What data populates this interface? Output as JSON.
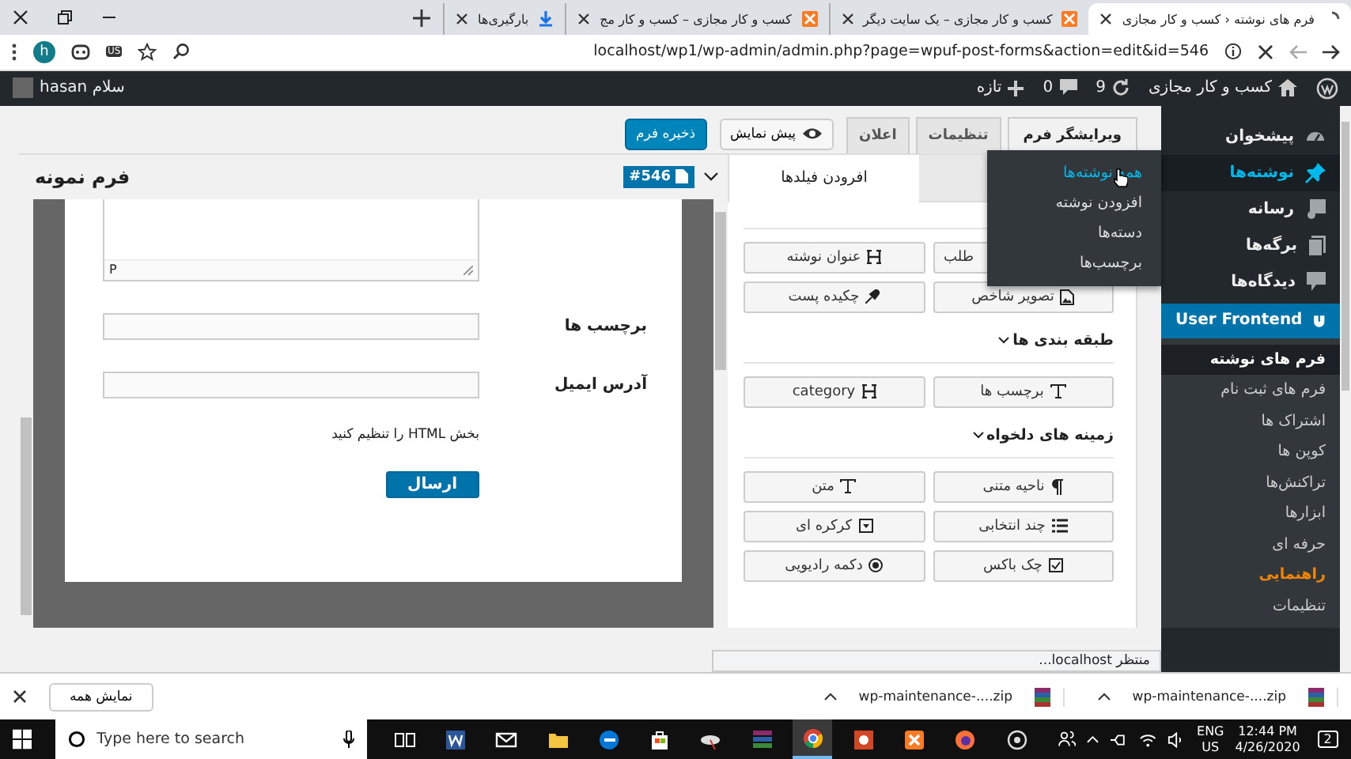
{
  "browser": {
    "tabs": [
      {
        "title": "فرم های نوشته ‹ کسب و کار مجازی",
        "kind": "loading",
        "selected": true
      },
      {
        "title": "کسب و کار مجازی – یک سایت دیگر",
        "kind": "site",
        "selected": false
      },
      {
        "title": "کسب و کار مجازی – کسب و کار مج",
        "kind": "site",
        "selected": false
      },
      {
        "title": "بارگیری‌ها",
        "kind": "download",
        "selected": false
      }
    ],
    "url": "localhost/wp1/wp-admin/admin.php?page=wpuf-post-forms&action=edit&id=546",
    "profile": "h",
    "extension_badge": "US"
  },
  "admin_bar": {
    "site": "کسب و کار مجازی",
    "updates": "9",
    "comments": "0",
    "new": "تازه",
    "greeting": "سلام hasan"
  },
  "toolbar": {
    "tabs": [
      {
        "label": "ویرایشگر فرم",
        "selected": true
      },
      {
        "label": "تنظیمات",
        "selected": false
      },
      {
        "label": "اعلان",
        "selected": false
      }
    ],
    "preview": "پیش نمایش",
    "save": "ذخیره فرم"
  },
  "form_preview": {
    "title": "فرم نمونه",
    "id_badge": "#546",
    "editor_path": "P",
    "fields": [
      {
        "label": "برچسب ها"
      },
      {
        "label": "آدرس ایمیل"
      }
    ],
    "html_note": "بخش HTML را تنظیم کنید",
    "submit": "ارسال"
  },
  "fields_panel": {
    "tab": "افرودن فیلدها",
    "post_fields": [
      {
        "label": "طلب",
        "kind": "plain",
        "partial": true
      },
      {
        "label": "عنوان نوشته",
        "kind": "heading",
        "partial": false
      },
      {
        "label": "تصویر شاخص",
        "kind": "image",
        "partial": false
      },
      {
        "label": "چکیده پست",
        "kind": "pin",
        "partial": false
      }
    ],
    "sections": [
      {
        "title": "طبقه بندی ها",
        "expanded": true,
        "buttons": [
          {
            "label": "برچسب ها",
            "kind": "text",
            "partial": false
          },
          {
            "label": "category",
            "kind": "heading",
            "partial": false
          }
        ]
      },
      {
        "title": "زمینه های دلخواه",
        "expanded": true,
        "buttons": [
          {
            "label": "ناحیه متنی",
            "kind": "paragraph",
            "partial": false
          },
          {
            "label": "متن",
            "kind": "text",
            "partial": false
          },
          {
            "label": "چند انتخابی",
            "kind": "list",
            "partial": false
          },
          {
            "label": "کرکره ای",
            "kind": "dropdown",
            "partial": false
          },
          {
            "label": "چک باکس",
            "kind": "checkbox",
            "partial": false
          },
          {
            "label": "دکمه رادیویی",
            "kind": "radio",
            "partial": false
          }
        ]
      }
    ]
  },
  "menu": {
    "items": [
      {
        "label": "پیشخوان",
        "kind": "dashboard",
        "selected": false,
        "open": false
      },
      {
        "label": "نوشته‌ها",
        "kind": "pin",
        "selected": false,
        "open": true,
        "flyout": [
          {
            "label": "همه نوشته‌ها",
            "selected": true
          },
          {
            "label": "افزودن نوشته",
            "selected": false
          },
          {
            "label": "دسته‌ها",
            "selected": false
          },
          {
            "label": "برچسب‌ها",
            "selected": false
          }
        ]
      },
      {
        "label": "رسانه",
        "kind": "media",
        "selected": false,
        "open": false
      },
      {
        "label": "برگه‌ها",
        "kind": "page",
        "selected": false,
        "open": false
      },
      {
        "label": "دیدگاه‌ها",
        "kind": "comment",
        "selected": false,
        "open": false
      },
      {
        "label": "User Frontend",
        "kind": "plugin",
        "selected": true,
        "open": false,
        "children": [
          {
            "label": "فرم های نوشته",
            "selected": true,
            "highlighted": false
          },
          {
            "label": "فرم های ثبت نام",
            "selected": false,
            "highlighted": false
          },
          {
            "label": "اشتراک ها",
            "selected": false,
            "highlighted": false
          },
          {
            "label": "کوپن ها",
            "selected": false,
            "highlighted": false
          },
          {
            "label": "تراکنش‌ها",
            "selected": false,
            "highlighted": false
          },
          {
            "label": "ابزارها",
            "selected": false,
            "highlighted": false
          },
          {
            "label": "حرفه ای",
            "selected": false,
            "highlighted": false
          },
          {
            "label": "راهنمایی",
            "selected": false,
            "highlighted": true
          },
          {
            "label": "تنظیمات",
            "selected": false,
            "highlighted": false
          }
        ]
      }
    ]
  },
  "status": "منتظر localhost...",
  "downloads": {
    "show_all": "نمایش همه",
    "files": [
      "wp-maintenance-....zip",
      "wp-maintenance-....zip"
    ]
  },
  "taskbar": {
    "search_placeholder": "Type here to search",
    "apps": [
      {
        "kind": "taskview",
        "selected": false
      },
      {
        "kind": "word",
        "selected": false
      },
      {
        "kind": "mail",
        "selected": false
      },
      {
        "kind": "folder",
        "selected": false
      },
      {
        "kind": "edge",
        "selected": false
      },
      {
        "kind": "store",
        "selected": false
      },
      {
        "kind": "dish",
        "selected": false
      },
      {
        "kind": "books",
        "selected": false
      },
      {
        "kind": "chrome",
        "selected": true
      },
      {
        "kind": "slides",
        "selected": false
      },
      {
        "kind": "xampp",
        "selected": false
      },
      {
        "kind": "firefox",
        "selected": false
      },
      {
        "kind": "ring",
        "selected": false
      }
    ],
    "language": "ENG",
    "region": "US",
    "time": "12:44 PM",
    "date": "4/26/2020",
    "notifications": "2"
  }
}
